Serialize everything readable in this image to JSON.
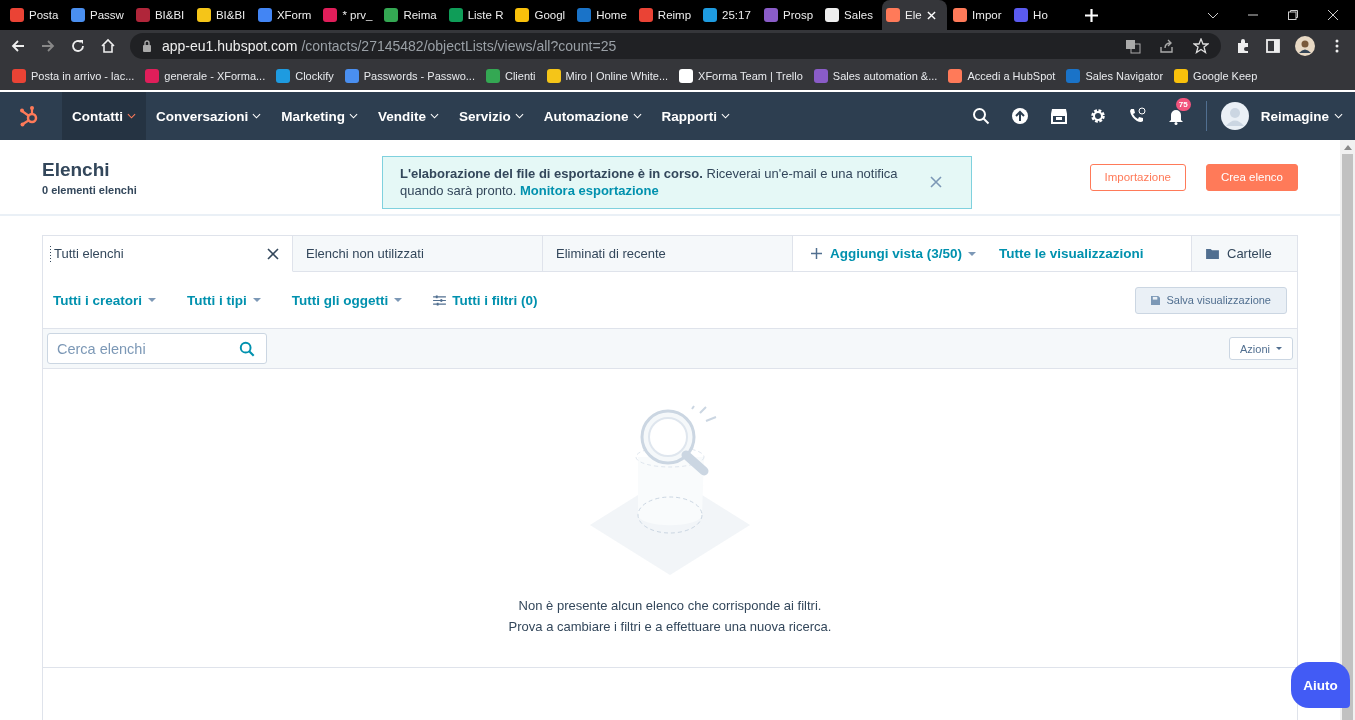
{
  "browser": {
    "tabs": [
      {
        "title": "Posta",
        "color": "#ea4335",
        "selected": false
      },
      {
        "title": "Passw",
        "color": "#4a8ff0",
        "selected": false
      },
      {
        "title": "BI&BI",
        "color": "#b0263a",
        "selected": false
      },
      {
        "title": "BI&BI",
        "color": "#f5c518",
        "selected": false
      },
      {
        "title": "XForm",
        "color": "#4285f4",
        "selected": false
      },
      {
        "title": "* prv_",
        "color": "#e01e5a",
        "selected": false
      },
      {
        "title": "Reima",
        "color": "#34a853",
        "selected": false
      },
      {
        "title": "Liste R",
        "color": "#0f9d58",
        "selected": false
      },
      {
        "title": "Googl",
        "color": "#f9c10b",
        "selected": false
      },
      {
        "title": "Home",
        "color": "#1a73c8",
        "selected": false
      },
      {
        "title": "Reimp",
        "color": "#ea4335",
        "selected": false
      },
      {
        "title": "25:17",
        "color": "#1e9be0",
        "selected": false
      },
      {
        "title": "Prosp",
        "color": "#8a5cc8",
        "selected": false
      },
      {
        "title": "Sales",
        "color": "#eeeeee",
        "selected": false
      },
      {
        "title": "Ele",
        "color": "#ff7a59",
        "selected": true
      },
      {
        "title": "Impor",
        "color": "#ff7a59",
        "selected": false
      },
      {
        "title": "Ho",
        "color": "#5b5bf0",
        "selected": false
      }
    ],
    "address": {
      "host": "app-eu1.hubspot.com",
      "path": "/contacts/27145482/objectLists/views/all?count=25"
    },
    "bookmarks": [
      {
        "label": "Posta in arrivo - lac...",
        "color": "#ea4335"
      },
      {
        "label": "generale - XForma...",
        "color": "#e01e5a"
      },
      {
        "label": "Clockify",
        "color": "#1e9be0"
      },
      {
        "label": "Passwords - Passwo...",
        "color": "#4a8ff0"
      },
      {
        "label": "Clienti",
        "color": "#34a853"
      },
      {
        "label": "Miro | Online White...",
        "color": "#f5c518"
      },
      {
        "label": "XForma Team | Trello",
        "color": "#ffffff"
      },
      {
        "label": "Sales automation &...",
        "color": "#8a5cc8"
      },
      {
        "label": "Accedi a HubSpot",
        "color": "#ff7a59"
      },
      {
        "label": "Sales Navigator",
        "color": "#1a73c8"
      },
      {
        "label": "Google Keep",
        "color": "#f9c10b"
      }
    ]
  },
  "nav": {
    "items": [
      {
        "label": "Contatti",
        "selected": true
      },
      {
        "label": "Conversazioni",
        "selected": false
      },
      {
        "label": "Marketing",
        "selected": false
      },
      {
        "label": "Vendite",
        "selected": false
      },
      {
        "label": "Servizio",
        "selected": false
      },
      {
        "label": "Automazione",
        "selected": false
      },
      {
        "label": "Rapporti",
        "selected": false
      }
    ],
    "notification_count": "75",
    "user": "Reimagine"
  },
  "header": {
    "title": "Elenchi",
    "subtitle": "0 elementi elenchi"
  },
  "alert": {
    "message": "**L'elaborazione del file di esportazione è in corso.** Riceverai un'e-mail e una notifica quando sarà pronto.",
    "link": "Monitora esportazione"
  },
  "actions": [
    {
      "label": "Importazione",
      "kind": "secondary"
    },
    {
      "label": "Crea elenco",
      "kind": "primary"
    }
  ],
  "view_tabs": [
    {
      "label": "Tutti elenchi",
      "selected": true
    },
    {
      "label": "Elenchi non utilizzati",
      "selected": false
    },
    {
      "label": "Eliminati di recente",
      "selected": false
    }
  ],
  "add_view": "Aggiungi vista (3/50)",
  "all_views": "Tutte le visualizzazioni",
  "folders": "Cartelle",
  "filters": [
    {
      "label": "Tutti i creatori",
      "kind": "dropdown"
    },
    {
      "label": "Tutti i tipi",
      "kind": "dropdown"
    },
    {
      "label": "Tutti gli oggetti",
      "kind": "dropdown"
    },
    {
      "label": "Tutti i filtri (0)",
      "kind": "panel"
    }
  ],
  "save_view": "Salva visualizzazione",
  "search": {
    "placeholder": "Cerca elenchi"
  },
  "actions_menu": "Azioni",
  "empty_state": [
    "Non è presente alcun elenco che corrisponde ai filtri.",
    "Prova a cambiare i filtri e a effettuare una nuova ricerca."
  ],
  "help": "Aiuto"
}
